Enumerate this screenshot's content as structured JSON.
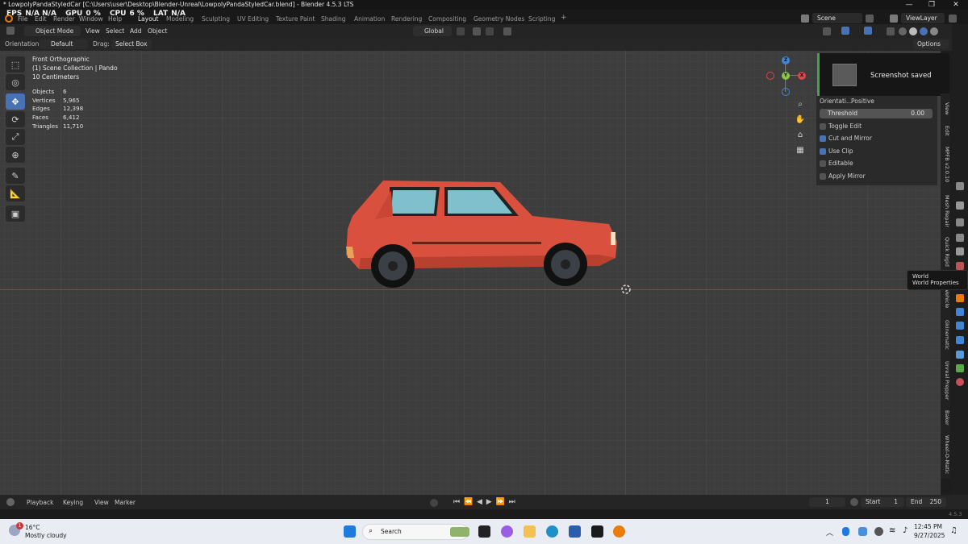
{
  "window": {
    "title": "* LowpolyPandaStyledCar [C:\\Users\\user\\Desktop\\Blender-Unreal\\LowpolyPandaStyledCar.blend] - Blender 4.5.3 LTS",
    "minimize": "—",
    "maximize": "❐",
    "close": "✕"
  },
  "perf": {
    "fps_label": "FPS",
    "fps": "N/A N/A",
    "gpu_label": "GPU",
    "gpu": "0 %",
    "cpu_label": "CPU",
    "cpu": "6 %",
    "lat_label": "LAT",
    "lat": "N/A"
  },
  "menus": [
    "File",
    "Edit",
    "Render",
    "Window",
    "Help"
  ],
  "workspaces": [
    {
      "label": "Layout",
      "active": true
    },
    {
      "label": "Modeling"
    },
    {
      "label": "Sculpting"
    },
    {
      "label": "UV Editing"
    },
    {
      "label": "Texture Paint"
    },
    {
      "label": "Shading"
    },
    {
      "label": "Animation"
    },
    {
      "label": "Rendering"
    },
    {
      "label": "Compositing"
    },
    {
      "label": "Geometry Nodes"
    },
    {
      "label": "Scripting"
    }
  ],
  "add_workspace": "+",
  "scene": {
    "name": "Scene",
    "view_layer": "ViewLayer"
  },
  "header": {
    "mode": "Object Mode",
    "menus": [
      "View",
      "Select",
      "Add",
      "Object"
    ],
    "transform_orientation": "Global"
  },
  "tool_settings": {
    "orientation_label": "Orientation:",
    "orientation_value": "Default",
    "drag_label": "Drag:",
    "drag_value": "Select Box",
    "options": "Options"
  },
  "viewport": {
    "view_name": "Front Orthographic",
    "collection": "(1) Scene Collection | Pando",
    "scale": "10 Centimeters",
    "stats": [
      {
        "label": "Objects",
        "value": "6"
      },
      {
        "label": "Vertices",
        "value": "5,965"
      },
      {
        "label": "Edges",
        "value": "12,398"
      },
      {
        "label": "Faces",
        "value": "6,412"
      },
      {
        "label": "Triangles",
        "value": "11,710"
      }
    ]
  },
  "gizmo": {
    "x": "X",
    "y": "Y",
    "z": "Z"
  },
  "toast": {
    "message": "Screenshot saved"
  },
  "npanel": {
    "orientation_label": "Orientati...",
    "orientation_value": "Positive",
    "threshold_label": "Threshold",
    "threshold_value": "0.00",
    "checks": [
      {
        "label": "Toggle Edit",
        "checked": false
      },
      {
        "label": "Cut and Mirror",
        "checked": true
      },
      {
        "label": "Use Clip",
        "checked": true
      },
      {
        "label": "Editable",
        "checked": false
      },
      {
        "label": "Apply Mirror",
        "checked": false
      }
    ]
  },
  "side_tabs": [
    "View",
    "Edit",
    "MPFB v2.0.10",
    "Mesh Repair",
    "Quick Rigid",
    "Vehicle",
    "Gkinematic",
    "Unreal Prepper",
    "Baker",
    "Wheel-O-Matic"
  ],
  "tooltip": {
    "title": "World",
    "subtitle": "World Properties"
  },
  "timeline": {
    "menus": [
      "Playback",
      "Keying",
      "View",
      "Marker"
    ],
    "current_frame": "1",
    "start_label": "Start",
    "start": "1",
    "end_label": "End",
    "end": "250"
  },
  "version": "4.5.3",
  "taskbar": {
    "weather_temp": "16°C",
    "weather_desc": "Mostly cloudy",
    "weather_badge": "1",
    "search": "Search",
    "time": "12:45 PM",
    "date": "9/27/2025"
  },
  "colors": {
    "accent": "#4772b3",
    "car_body": "#d9503f",
    "glass": "#7fc0cc",
    "x_axis": "#e0434a",
    "y_axis": "#8bc34a",
    "z_axis": "#3f86d6"
  }
}
